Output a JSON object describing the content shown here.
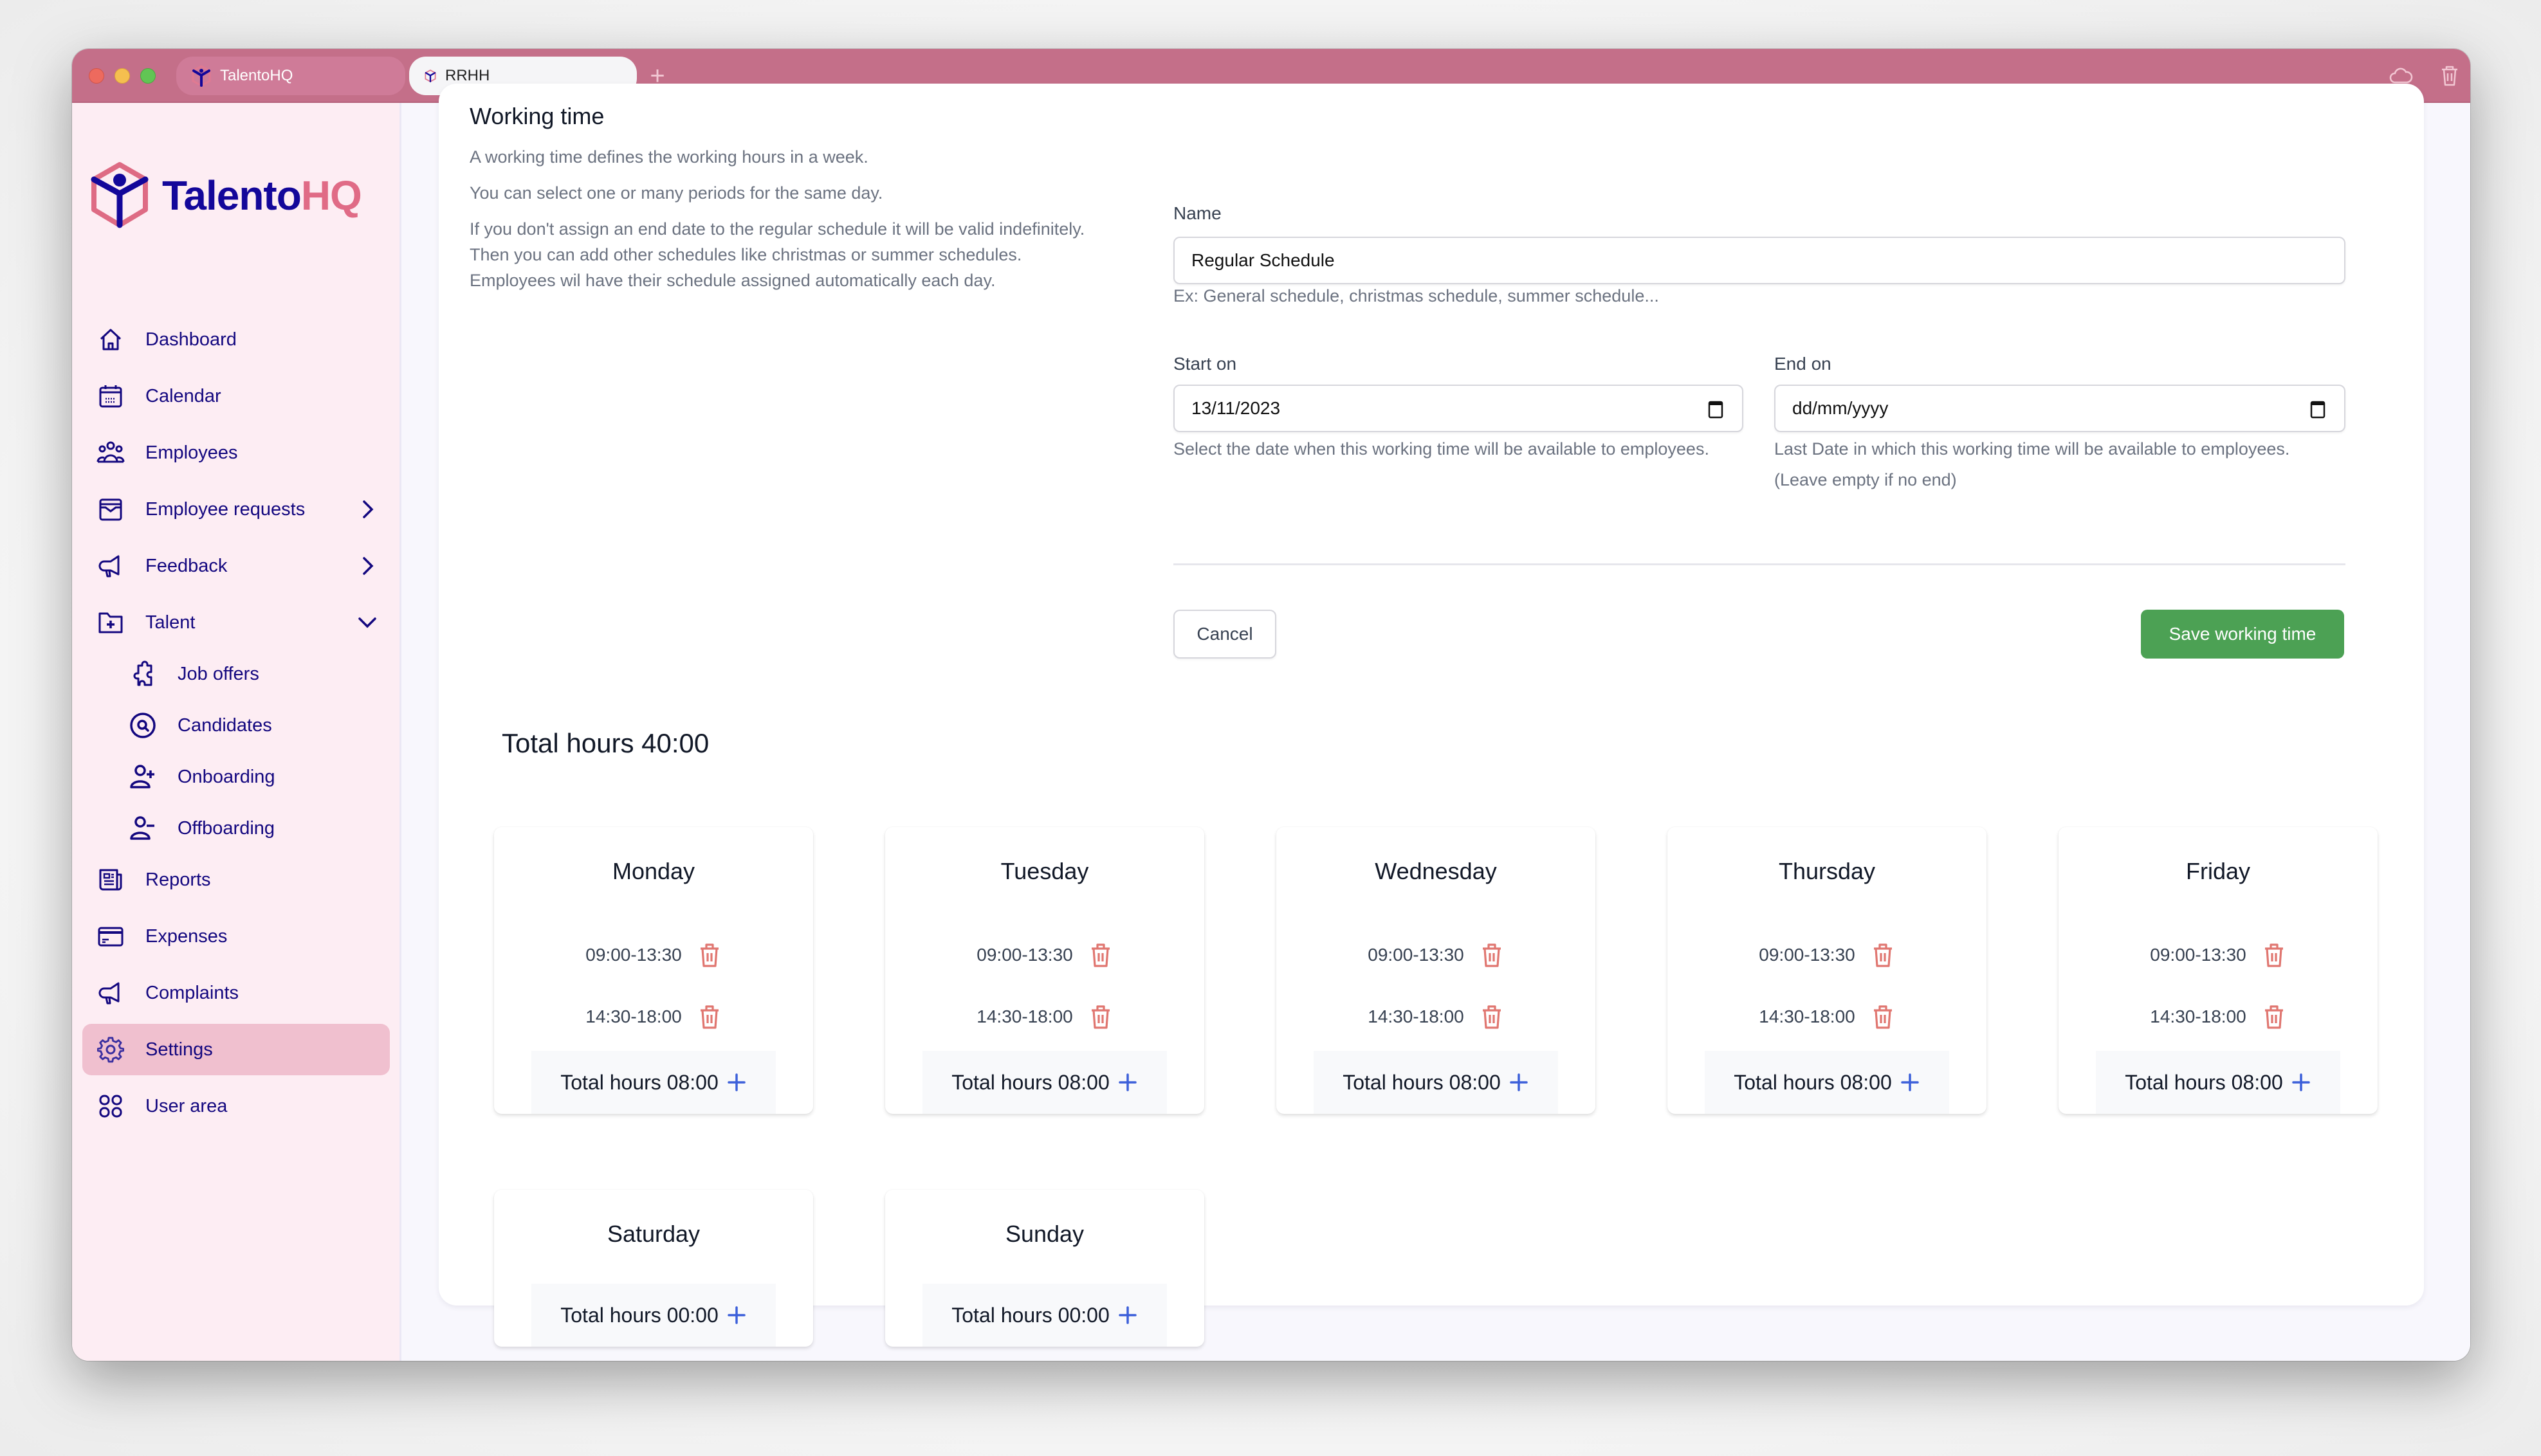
{
  "browser": {
    "tabs": [
      {
        "label": "TalentoHQ",
        "active": false
      },
      {
        "label": "RRHH",
        "active": true
      }
    ],
    "new_tab_label": "+",
    "status_url": "http://localhost:3000/admin/settings"
  },
  "brand": {
    "name_part1": "Talento",
    "name_part2": "HQ",
    "primary_color": "#13079a",
    "accent_color": "#e06b86"
  },
  "sidebar": {
    "items": [
      {
        "label": "Dashboard",
        "icon": "home-icon"
      },
      {
        "label": "Calendar",
        "icon": "calendar-icon"
      },
      {
        "label": "Employees",
        "icon": "users-icon"
      },
      {
        "label": "Employee requests",
        "icon": "inbox-icon",
        "chevron": "right"
      },
      {
        "label": "Feedback",
        "icon": "megaphone-icon",
        "chevron": "right"
      },
      {
        "label": "Talent",
        "icon": "folder-plus-icon",
        "chevron": "down",
        "expanded": true
      },
      {
        "label": "Job offers",
        "icon": "puzzle-icon",
        "sub": true
      },
      {
        "label": "Candidates",
        "icon": "search-circle-icon",
        "sub": true
      },
      {
        "label": "Onboarding",
        "icon": "user-plus-icon",
        "sub": true
      },
      {
        "label": "Offboarding",
        "icon": "user-minus-icon",
        "sub": true
      },
      {
        "label": "Reports",
        "icon": "newspaper-icon"
      },
      {
        "label": "Expenses",
        "icon": "credit-card-icon"
      },
      {
        "label": "Complaints",
        "icon": "megaphone-icon"
      },
      {
        "label": "Settings",
        "icon": "gear-icon",
        "active": true
      },
      {
        "label": "User area",
        "icon": "grid-icon"
      }
    ]
  },
  "working_time": {
    "title": "Working time",
    "desc1": "A working time defines the working hours in a week.",
    "desc2": "You can select one or many periods for the same day.",
    "desc3": "If you don't assign an end date to the regular schedule it will be valid indefinitely. Then you can add other schedules like christmas or summer schedules. Employees wil have their schedule assigned automatically each day."
  },
  "form": {
    "name_label": "Name",
    "name_value": "Regular Schedule",
    "name_hint": "Ex: General schedule, christmas schedule, summer schedule...",
    "start_label": "Start on",
    "start_value": "13/11/2023",
    "start_hint": "Select the date when this working time will be available to employees.",
    "end_label": "End on",
    "end_placeholder": "dd/mm/yyyy",
    "end_hint": "Last Date in which this working time will be available to employees. (Leave empty if no end)",
    "cancel_label": "Cancel",
    "save_label": "Save working time",
    "save_color": "#4ca154"
  },
  "schedule": {
    "total_label": "Total hours 40:00",
    "days": [
      {
        "name": "Monday",
        "periods": [
          "09:00-13:30",
          "14:30-18:00"
        ],
        "total": "Total hours 08:00"
      },
      {
        "name": "Tuesday",
        "periods": [
          "09:00-13:30",
          "14:30-18:00"
        ],
        "total": "Total hours 08:00"
      },
      {
        "name": "Wednesday",
        "periods": [
          "09:00-13:30",
          "14:30-18:00"
        ],
        "total": "Total hours 08:00"
      },
      {
        "name": "Thursday",
        "periods": [
          "09:00-13:30",
          "14:30-18:00"
        ],
        "total": "Total hours 08:00"
      },
      {
        "name": "Friday",
        "periods": [
          "09:00-13:30",
          "14:30-18:00"
        ],
        "total": "Total hours 08:00"
      },
      {
        "name": "Saturday",
        "periods": [],
        "total": "Total hours 00:00"
      },
      {
        "name": "Sunday",
        "periods": [],
        "total": "Total hours 00:00"
      }
    ]
  }
}
